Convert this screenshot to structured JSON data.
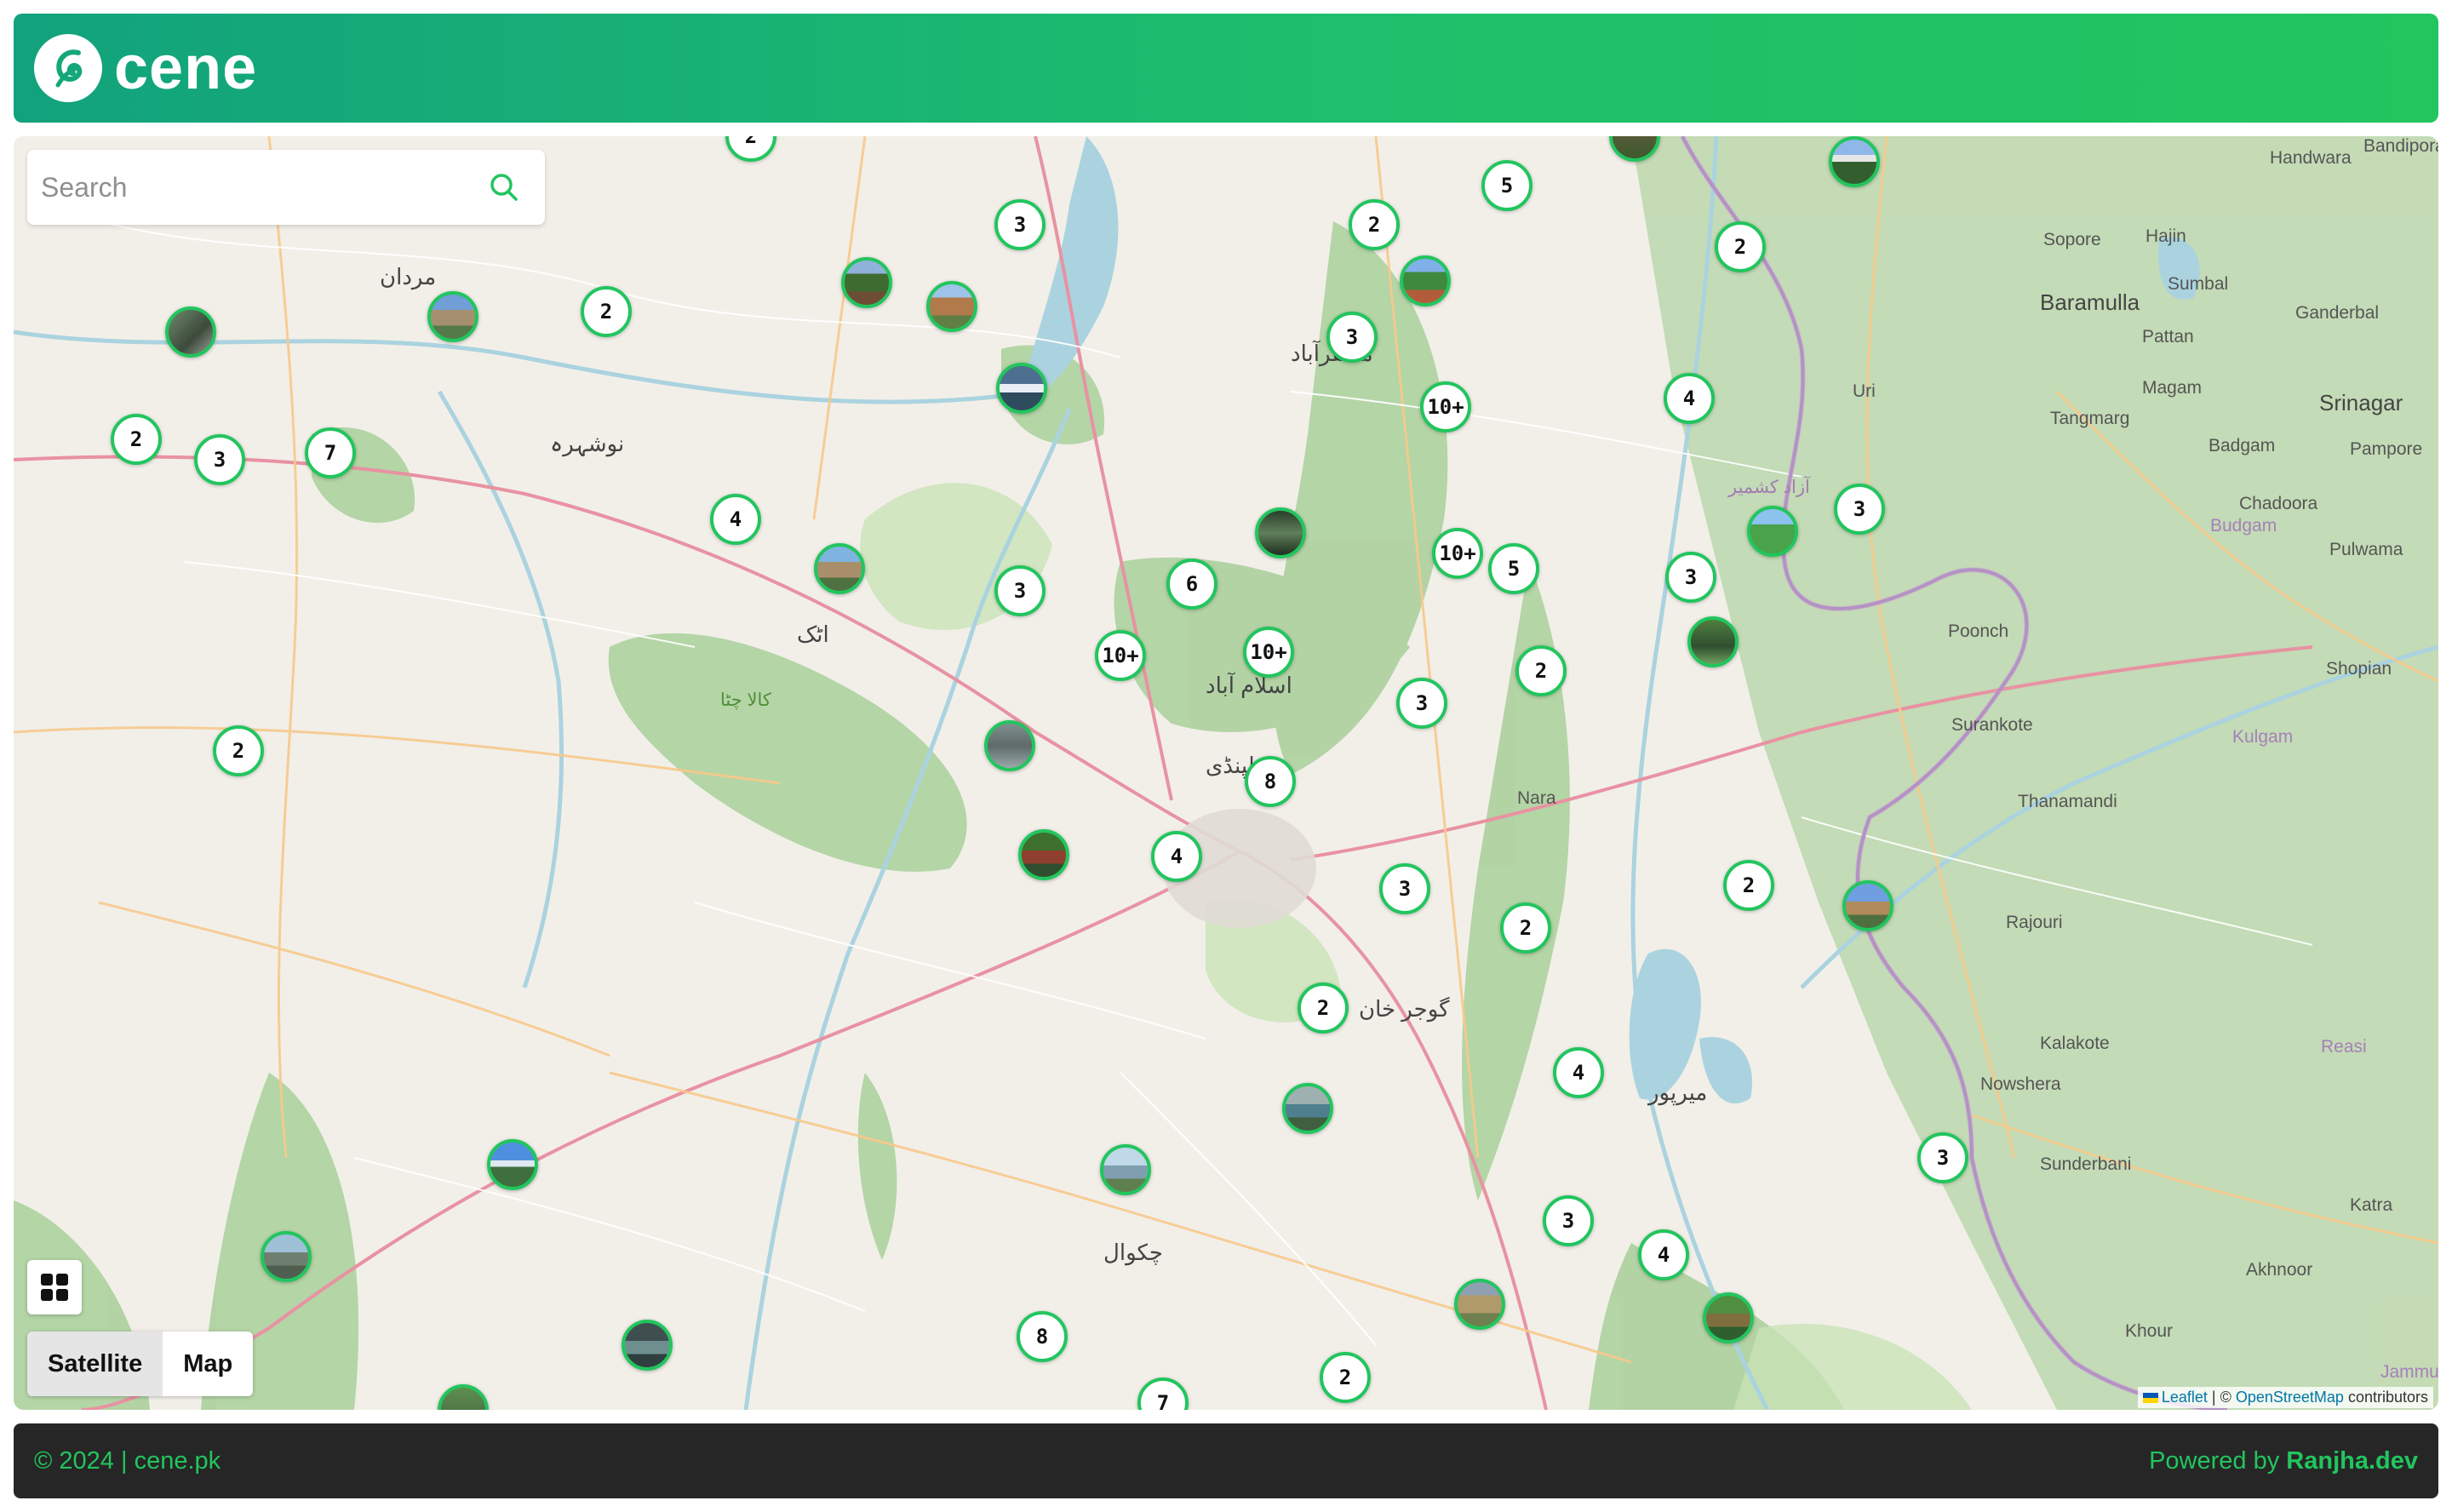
{
  "header": {
    "logo_text": "cene"
  },
  "search": {
    "placeholder": "Search"
  },
  "map_toggle": {
    "satellite_label": "Satellite",
    "map_label": "Map",
    "active": "Satellite"
  },
  "attribution": {
    "leaflet": "Leaflet",
    "separator": " | © ",
    "osm": "OpenStreetMap",
    "suffix": " contributors"
  },
  "footer": {
    "copyright": "© 2024 | cene.pk",
    "powered_prefix": "Powered by ",
    "powered_name": "Ranjha.dev"
  },
  "clusters": [
    "2",
    "3",
    "2",
    "5",
    "2",
    "3",
    "10+",
    "4",
    "2",
    "3",
    "7",
    "4",
    "3",
    "6",
    "10+",
    "5",
    "3",
    "10+",
    "10+",
    "3",
    "2",
    "2",
    "2",
    "8",
    "4",
    "3",
    "2",
    "2",
    "3",
    "2",
    "4",
    "3",
    "4",
    "3",
    "8",
    "2",
    "7"
  ],
  "map_labels": [
    "Handwara",
    "Bandipora",
    "Sopore",
    "Hajin",
    "Baramulla",
    "Sumbal",
    "Ganderbal",
    "Pattan",
    "Uri",
    "Magam",
    "Srinagar",
    "Tangmarg",
    "Badgam",
    "Pampore",
    "Budgam",
    "Chadoora",
    "Pulwama",
    "Poonch",
    "Shopian",
    "Surankote",
    "Kulgam",
    "Thanamandi",
    "Nara",
    "Rajouri",
    "Kalakote",
    "Reasi",
    "Nowshera",
    "Sunderbani",
    "Akhnoor",
    "Khour",
    "Jammu",
    "Katra",
    "آزاد کشمیر",
    "اسلام آباد",
    "راولپنڈی",
    "گوجر خان",
    "چکوال",
    "مردان",
    "نوشہرہ",
    "مظفرآباد",
    "میرپور",
    "اٹک",
    "کالا چٹا"
  ]
}
